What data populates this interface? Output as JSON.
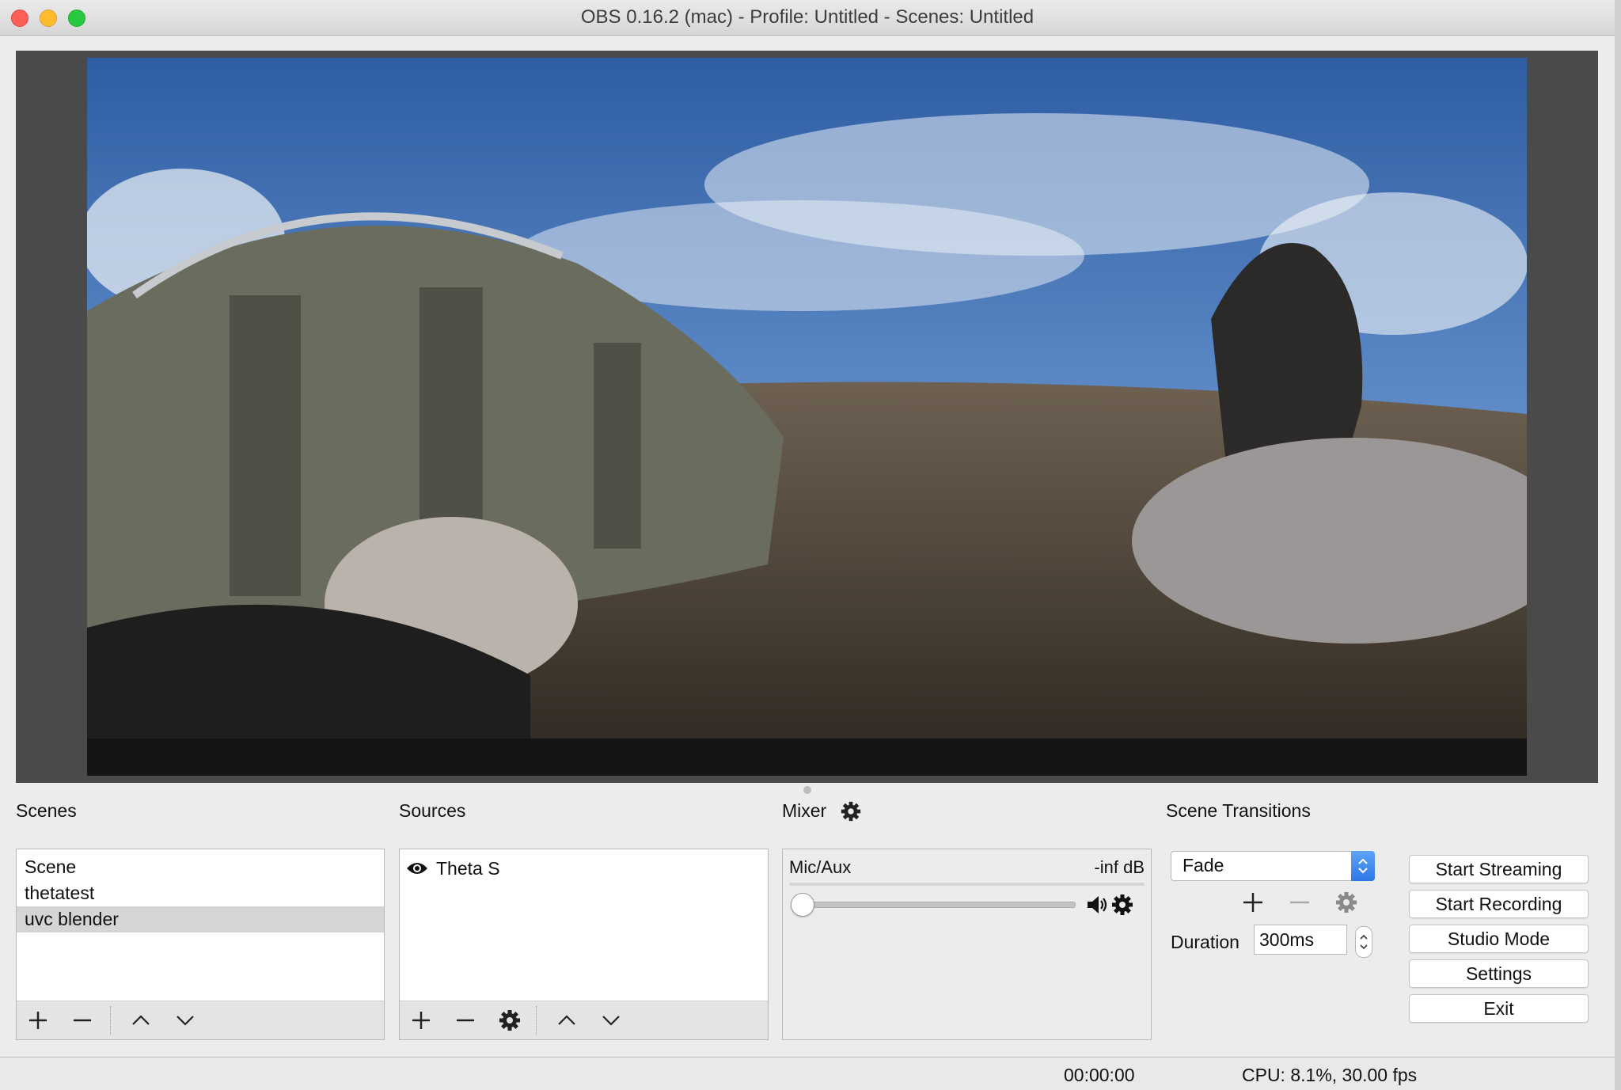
{
  "window": {
    "title": "OBS 0.16.2 (mac) - Profile: Untitled - Scenes: Untitled"
  },
  "scenes": {
    "title": "Scenes",
    "items": [
      "Scene",
      "thetatest",
      "uvc blender"
    ],
    "selected_index": 2,
    "toolbar": [
      "plus-icon",
      "minus-icon",
      "chevron-up-icon",
      "chevron-down-icon"
    ]
  },
  "sources": {
    "title": "Sources",
    "items": [
      {
        "label": "Theta S",
        "visible": true
      }
    ],
    "toolbar": [
      "plus-icon",
      "minus-icon",
      "gear-icon",
      "chevron-up-icon",
      "chevron-down-icon"
    ]
  },
  "mixer": {
    "title": "Mixer",
    "channels": [
      {
        "name": "Mic/Aux",
        "level": "-inf dB",
        "volume": 0
      }
    ]
  },
  "transitions": {
    "title": "Scene Transitions",
    "selected": "Fade",
    "duration_label": "Duration",
    "duration_value": "300ms"
  },
  "controls": {
    "start_streaming": "Start Streaming",
    "start_recording": "Start Recording",
    "studio_mode": "Studio Mode",
    "settings": "Settings",
    "exit": "Exit"
  },
  "status": {
    "time": "00:00:00",
    "cpu": "CPU: 8.1%, 30.00 fps"
  },
  "colors": {
    "accent": "#3b82ec",
    "preview_bg": "#4a4a4a",
    "selected_row": "#d5d5d5"
  }
}
